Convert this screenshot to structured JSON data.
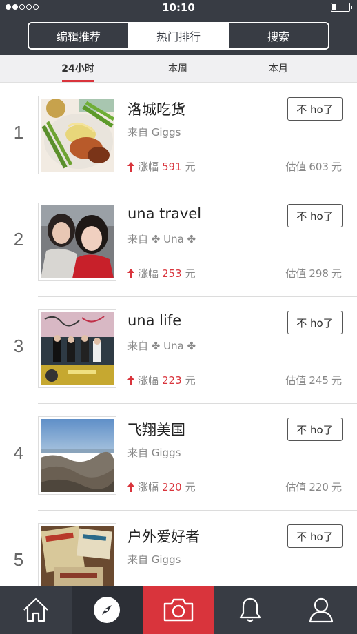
{
  "status_bar": {
    "time": "10:10",
    "signal_bars_filled": 2,
    "signal_bars_total": 5,
    "battery_level": 0.25
  },
  "top_segments": [
    {
      "label": "编辑推荐"
    },
    {
      "label": "热门排行"
    },
    {
      "label": "搜索"
    }
  ],
  "time_tabs": [
    {
      "label": "24小时"
    },
    {
      "label": "本周"
    },
    {
      "label": "本月"
    }
  ],
  "list": [
    {
      "rank": "1",
      "title": "洛城吃货",
      "source": "来自 Giggs",
      "gain_label": "涨幅",
      "gain": "591",
      "unit": "元",
      "value_label": "估值",
      "value": "603",
      "button": "不 ho了"
    },
    {
      "rank": "2",
      "title": "una travel",
      "source": "来自 ✤ Una ✤",
      "gain_label": "涨幅",
      "gain": "253",
      "unit": "元",
      "value_label": "估值",
      "value": "298",
      "button": "不 ho了"
    },
    {
      "rank": "3",
      "title": "una life",
      "source": "来自 ✤ Una ✤",
      "gain_label": "涨幅",
      "gain": "223",
      "unit": "元",
      "value_label": "估值",
      "value": "245",
      "button": "不 ho了"
    },
    {
      "rank": "4",
      "title": "飞翔美国",
      "source": "来自 Giggs",
      "gain_label": "涨幅",
      "gain": "220",
      "unit": "元",
      "value_label": "估值",
      "value": "220",
      "button": "不 ho了"
    },
    {
      "rank": "5",
      "title": "户外爱好者",
      "source": "来自 Giggs",
      "gain_label": "",
      "gain": "",
      "unit": "",
      "value_label": "",
      "value": "",
      "button": "不 ho了"
    }
  ],
  "tabbar": {
    "icons": [
      "home-icon",
      "compass-icon",
      "camera-icon",
      "bell-icon",
      "profile-icon"
    ]
  },
  "colors": {
    "header": "#383c44",
    "accent_red": "#d9343c",
    "tab_strip": "#f0f0f2"
  }
}
